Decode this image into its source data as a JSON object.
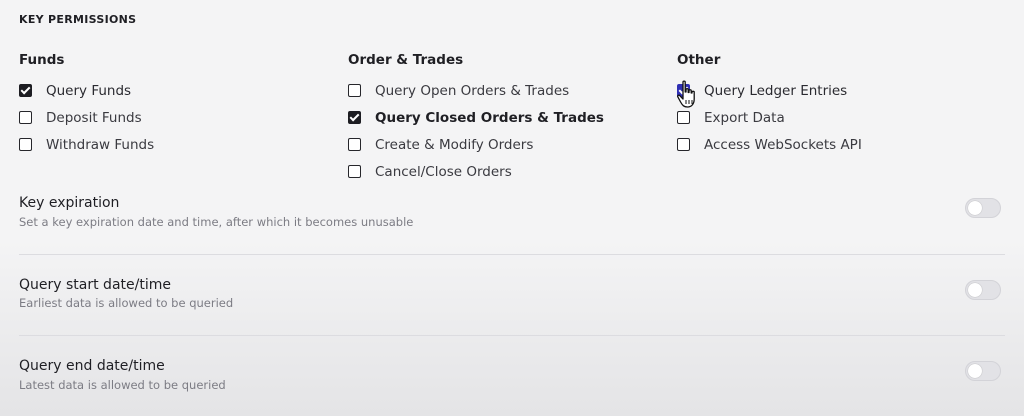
{
  "header": {
    "title": "KEY PERMISSIONS"
  },
  "permissions": {
    "funds": {
      "title": "Funds",
      "items": [
        {
          "label": "Query Funds",
          "checked": true
        },
        {
          "label": "Deposit Funds",
          "checked": false
        },
        {
          "label": "Withdraw Funds",
          "checked": false
        }
      ]
    },
    "orders": {
      "title": "Order & Trades",
      "items": [
        {
          "label": "Query Open Orders & Trades",
          "checked": false
        },
        {
          "label": "Query Closed Orders & Trades",
          "checked": true
        },
        {
          "label": "Create & Modify Orders",
          "checked": false
        },
        {
          "label": "Cancel/Close Orders",
          "checked": false
        }
      ]
    },
    "other": {
      "title": "Other",
      "items": [
        {
          "label": "Query Ledger Entries",
          "checked": true
        },
        {
          "label": "Export Data",
          "checked": false
        },
        {
          "label": "Access WebSockets API",
          "checked": false
        }
      ]
    }
  },
  "settings": {
    "key_expiration": {
      "title": "Key expiration",
      "description": "Set a key expiration date and time, after which it becomes unusable",
      "enabled": false
    },
    "query_start": {
      "title": "Query start date/time",
      "description": "Earliest data is allowed to be queried",
      "enabled": false
    },
    "query_end": {
      "title": "Query end date/time",
      "description": "Latest data is allowed to be queried",
      "enabled": false
    }
  },
  "colors": {
    "accent": "#2f2fb3",
    "checkbox_checked": "#1d1d22"
  }
}
